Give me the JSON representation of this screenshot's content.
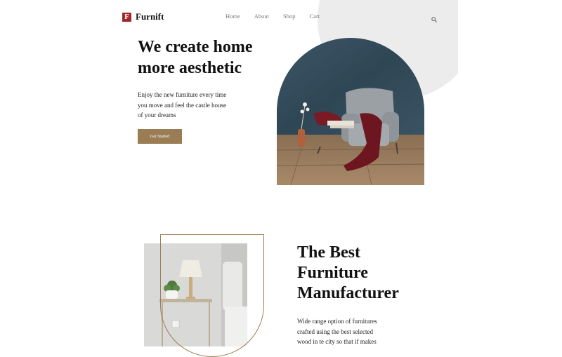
{
  "brand": {
    "logo_letter": "F",
    "name": "Furnift"
  },
  "nav": {
    "items": [
      "Home",
      "About",
      "Shop",
      "Cart"
    ]
  },
  "icons": {
    "search": "search-icon"
  },
  "hero": {
    "title_line1": "We create home",
    "title_line2": "more aesthetic",
    "text_line1": "Enjoy the new furniture every time",
    "text_line2": "you move and feel the castle house",
    "text_line3": "of your dreams",
    "cta_label": "Get Started"
  },
  "section2": {
    "title_line1": "The Best",
    "title_line2": "Furniture",
    "title_line3": "Manufacturer",
    "text_line1": "Wide range option of furnitures",
    "text_line2": "crafted using the best selected",
    "text_line3": "wood in te city so that if makes"
  },
  "colors": {
    "accent": "#9a7d54",
    "logo": "#a0282b",
    "circle": "#ececec"
  }
}
